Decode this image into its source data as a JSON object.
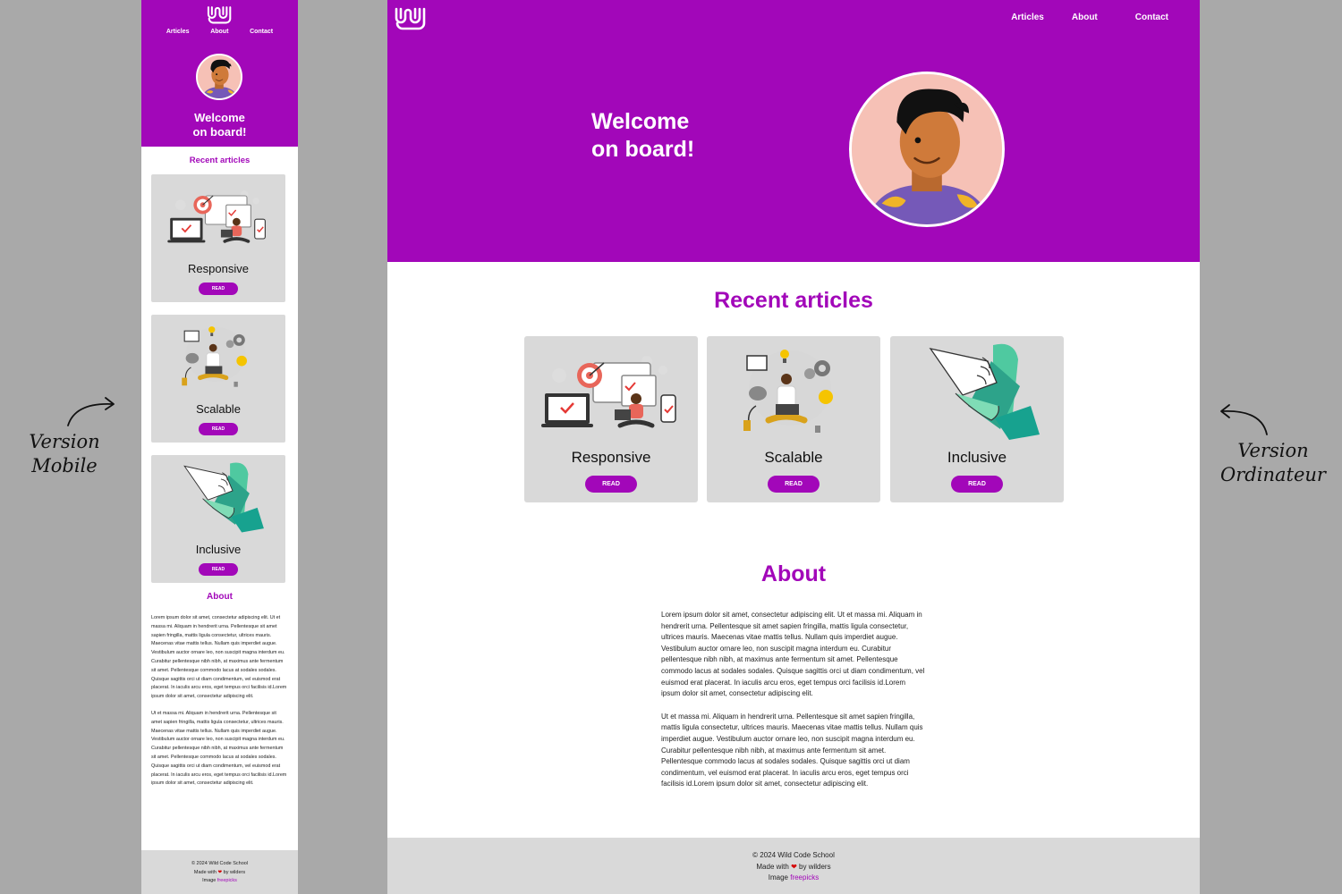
{
  "brand": {
    "primary_color": "#a207b9",
    "card_color": "#d9d9d9",
    "footer_color": "#d9d9d9",
    "logo_icon": "wave-logo-icon"
  },
  "nav": {
    "articles": "Articles",
    "about": "About",
    "contact": "Contact"
  },
  "hero": {
    "welcome_line1": "Welcome",
    "welcome_line2": "on board!",
    "avatar_icon": "avatar-illustration"
  },
  "articles": {
    "title": "Recent articles",
    "cards": [
      {
        "title": "Responsive",
        "button": "READ",
        "icon": "responsive-illustration"
      },
      {
        "title": "Scalable",
        "button": "READ",
        "icon": "scalable-illustration"
      },
      {
        "title": "Inclusive",
        "button": "READ",
        "icon": "inclusive-hands-illustration"
      }
    ]
  },
  "about": {
    "title": "About",
    "paragraph1": "Lorem ipsum dolor sit amet, consectetur adipiscing elit. Ut et massa mi. Aliquam in hendrerit urna. Pellentesque sit amet sapien fringilla, mattis ligula consectetur, ultrices mauris. Maecenas vitae mattis tellus. Nullam quis imperdiet augue. Vestibulum auctor ornare leo, non suscipit magna interdum eu. Curabitur pellentesque nibh nibh, at maximus ante fermentum sit amet. Pellentesque commodo lacus at sodales sodales. Quisque sagittis orci ut diam condimentum, vel euismod erat placerat. In iaculis arcu eros, eget tempus orci facilisis id.Lorem ipsum dolor sit amet, consectetur adipiscing elit.",
    "paragraph2": "Ut et massa mi. Aliquam in hendrerit urna. Pellentesque sit amet sapien fringilla, mattis ligula consectetur, ultrices mauris. Maecenas vitae mattis tellus. Nullam quis imperdiet augue. Vestibulum auctor ornare leo, non suscipit magna interdum eu. Curabitur pellentesque nibh nibh, at maximus ante fermentum sit amet. Pellentesque commodo lacus at sodales sodales. Quisque sagittis orci ut diam condimentum, vel euismod erat placerat. In iaculis arcu eros, eget tempus orci facilisis id.Lorem ipsum dolor sit amet, consectetur adipiscing elit."
  },
  "footer": {
    "copyright": "© 2024 Wild Code School",
    "made_prefix": "Made with",
    "heart": "❤",
    "made_suffix": "by wilders",
    "image_prefix": "Image",
    "image_link": "freepicks"
  },
  "annotations": {
    "mobile_line1": "Version",
    "mobile_line2": "Mobile",
    "desktop_line1": "Version",
    "desktop_line2": "Ordinateur"
  }
}
